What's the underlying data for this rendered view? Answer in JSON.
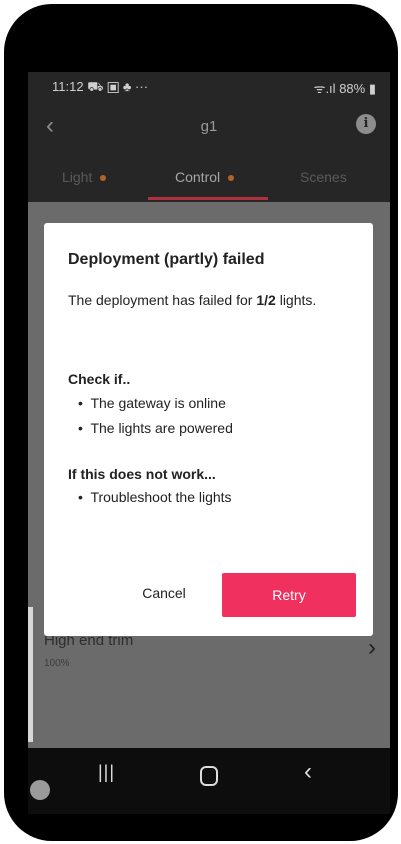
{
  "status_bar": {
    "time": "11:12",
    "left_icons": "⛟ ▣ ♣ ···",
    "signal": "ᯤ.ıl",
    "battery": "88%"
  },
  "app_bar": {
    "title": "g1"
  },
  "tabs": [
    {
      "label": "Light"
    },
    {
      "label": "Control"
    },
    {
      "label": "Scenes"
    }
  ],
  "background_item": {
    "title": "High end trim",
    "subtitle": "100%"
  },
  "dialog": {
    "title": "Deployment (partly) failed",
    "message_prefix": "The deployment has failed for ",
    "message_count": "1/2",
    "message_suffix": " lights.",
    "check_heading": "Check if..",
    "check_items": [
      "The gateway is online",
      "The lights are powered"
    ],
    "notwork_heading": "If this does not work...",
    "notwork_items": [
      "Troubleshoot the lights"
    ],
    "cancel_label": "Cancel",
    "retry_label": "Retry"
  },
  "colors": {
    "accent": "#f0305f",
    "tab_dot": "#b5622a",
    "appbar": "#262626"
  },
  "icons": [
    "back-arrow-icon",
    "info-icon",
    "chevron-right-icon",
    "recents-icon",
    "home-icon",
    "back-nav-icon"
  ]
}
